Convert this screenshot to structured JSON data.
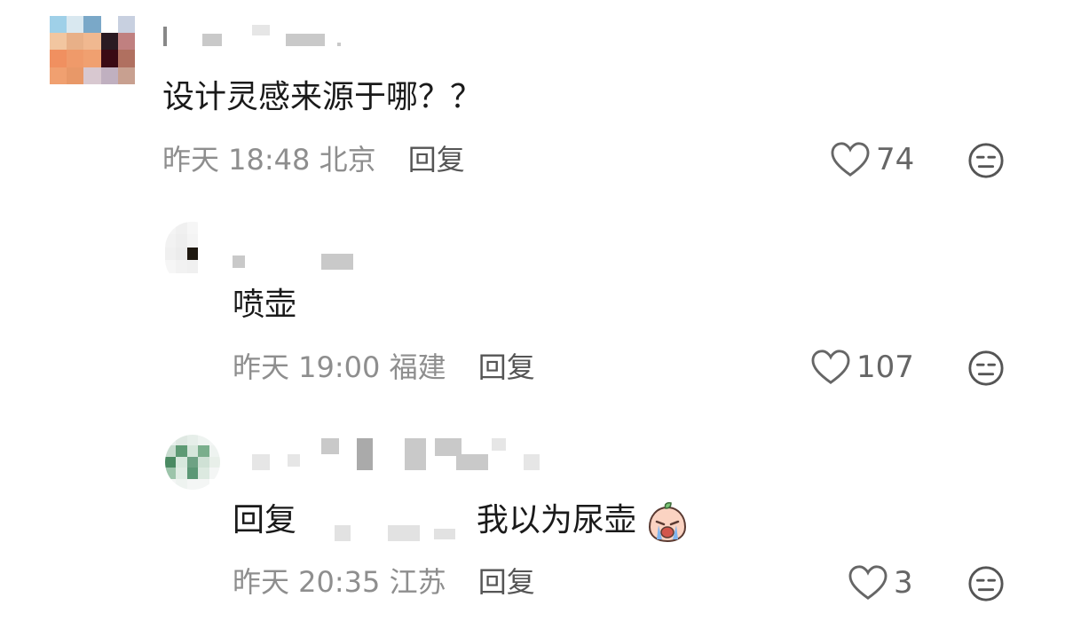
{
  "comments": [
    {
      "text": "设计灵感来源于哪？？",
      "time": "昨天 18:48",
      "location": "北京",
      "reply_label": "回复",
      "likes": "74",
      "avatar_colors": [
        "#9fd0e8",
        "#d9e8f0",
        "#7aa8c8",
        "#ffffff",
        "#c8d0e0",
        "#f2c6a0",
        "#e8b088",
        "#f0b890",
        "#2a1a22",
        "#c08080",
        "#f09060",
        "#ef9a6a",
        "#f0a070",
        "#3a0a14",
        "#b07060",
        "#f0a070",
        "#e89868",
        "#d8c8d0",
        "#c0b0c0",
        "#c8a090",
        "#ffffff",
        "#ffffff",
        "#ffffff",
        "#ffffff",
        "#ffffff"
      ]
    },
    {
      "text": "喷壶",
      "time": "昨天 19:00",
      "location": "福建",
      "reply_label": "回复",
      "likes": "107",
      "avatar_colors": [
        "#f4f4f4",
        "#f0f0f0",
        "#f6f6f6",
        "#ffffff",
        "#ffffff",
        "#f2f2f2",
        "#eeeeee",
        "#f4f4f4",
        "#ffffff",
        "#ffffff",
        "#f0f0f0",
        "#ececec",
        "#1e1810",
        "#ffffff",
        "#ffffff",
        "#f6f6f6",
        "#f2f2f2",
        "#f0f0f0",
        "#ffffff",
        "#ffffff",
        "#ffffff",
        "#ffffff",
        "#ffffff",
        "#ffffff",
        "#ffffff"
      ]
    },
    {
      "reply_prefix": "回复",
      "text": "我以为尿壶",
      "time": "昨天 20:35",
      "location": "江苏",
      "reply_label": "回复",
      "likes": "3",
      "avatar_colors": [
        "#e8f0ec",
        "#dfe8e2",
        "#e6eee9",
        "#eef3f0",
        "#f4f6f5",
        "#c8dccf",
        "#5e9a74",
        "#d6e6db",
        "#7aae8c",
        "#eef3f0",
        "#4a8a62",
        "#d8e8dd",
        "#6ea284",
        "#cfe1d5",
        "#e8efe9",
        "#9cc4aa",
        "#e0ece4",
        "#5c9876",
        "#dce9e0",
        "#f4f6f5",
        "#f4f6f5",
        "#eef3f0",
        "#f4f6f5",
        "#f4f6f5",
        "#ffffff"
      ]
    }
  ]
}
